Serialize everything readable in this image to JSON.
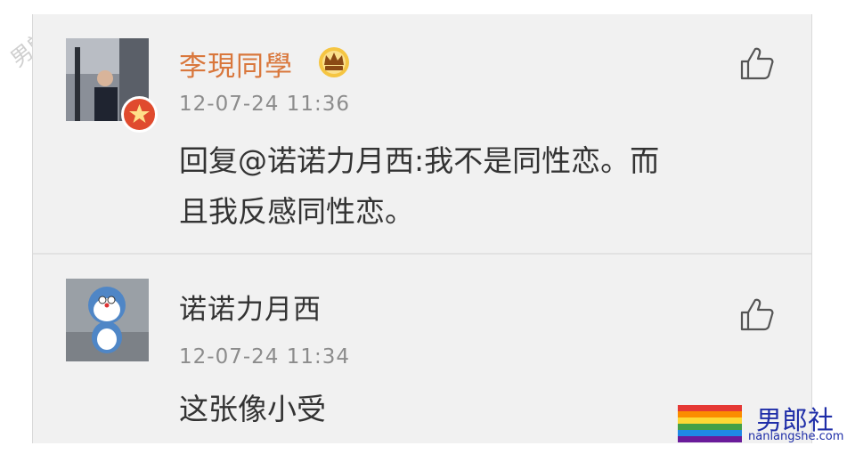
{
  "comments": [
    {
      "username": "李現同學",
      "timestamp": "12-07-24 11:36",
      "text_line1": "回复@诺诺力月西:我不是同性恋。而",
      "text_line2": "且我反感同性恋。",
      "verified_badge": "verified-v-icon",
      "member_badge": "crown-icon",
      "like_icon": "thumbs-up-icon",
      "username_color": "#d9773c"
    },
    {
      "username": "诺诺力月西",
      "timestamp": "12-07-24 11:34",
      "text_line1": "这张像小受",
      "like_icon": "thumbs-up-icon",
      "username_color": "#333333"
    }
  ],
  "watermark": {
    "text": "男郎社"
  },
  "logo": {
    "title": "男郎社",
    "url": "nanlangshe.com",
    "flag_colors": [
      "#e53935",
      "#fb8c00",
      "#fdd835",
      "#43a047",
      "#1e88e5",
      "#6a1b9a"
    ]
  }
}
